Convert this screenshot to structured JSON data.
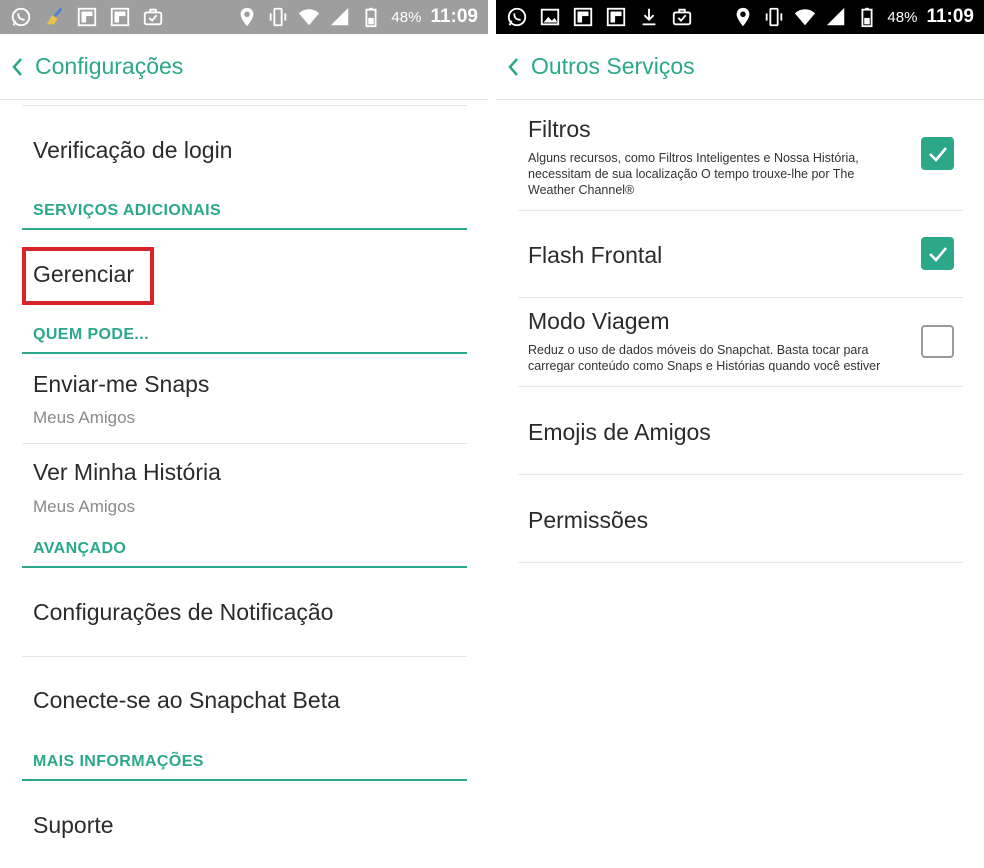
{
  "status_left": {
    "battery": "48%",
    "time": "11:09",
    "icons": [
      "whatsapp-icon",
      "cleaner-icon",
      "flipboard-icon",
      "flipboard-icon",
      "briefcase-check-icon"
    ]
  },
  "status_right": {
    "battery": "48%",
    "time": "11:09",
    "icons": [
      "whatsapp-icon",
      "gallery-icon",
      "flipboard-icon",
      "flipboard-icon",
      "download-icon",
      "briefcase-check-icon"
    ]
  },
  "left_screen": {
    "title": "Configurações",
    "items": {
      "login_verification": "Verificação de login",
      "section_additional": "SERVIÇOS ADICIONAIS",
      "manage": "Gerenciar",
      "section_who_can": "QUEM PODE...",
      "send_snaps": "Enviar-me Snaps",
      "send_snaps_value": "Meus Amigos",
      "view_story": "Ver Minha História",
      "view_story_value": "Meus Amigos",
      "section_advanced": "AVANÇADO",
      "notification_settings": "Configurações de Notificação",
      "beta": "Conecte-se ao Snapchat Beta",
      "section_more_info": "MAIS INFORMAÇÕES",
      "support": "Suporte"
    }
  },
  "right_screen": {
    "title": "Outros Serviços",
    "filters": {
      "title": "Filtros",
      "description": "Alguns recursos, como Filtros Inteligentes e Nossa História, necessitam de sua localização O tempo trouxe-lhe por The Weather Channel®",
      "checked": true
    },
    "front_flash": {
      "title": "Flash Frontal",
      "checked": true
    },
    "travel_mode": {
      "title": "Modo Viagem",
      "description": "Reduz o uso de dados móveis do Snapchat. Basta tocar para carregar conteúdo como Snaps e Histórias quando você estiver em movimento.",
      "checked": false
    },
    "friend_emojis": "Emojis de Amigos",
    "permissions": "Permissões"
  },
  "colors": {
    "accent": "#2aa889",
    "highlight": "#d8232a",
    "statusbar_left": "#9e9e9e",
    "statusbar_right": "#000000"
  }
}
